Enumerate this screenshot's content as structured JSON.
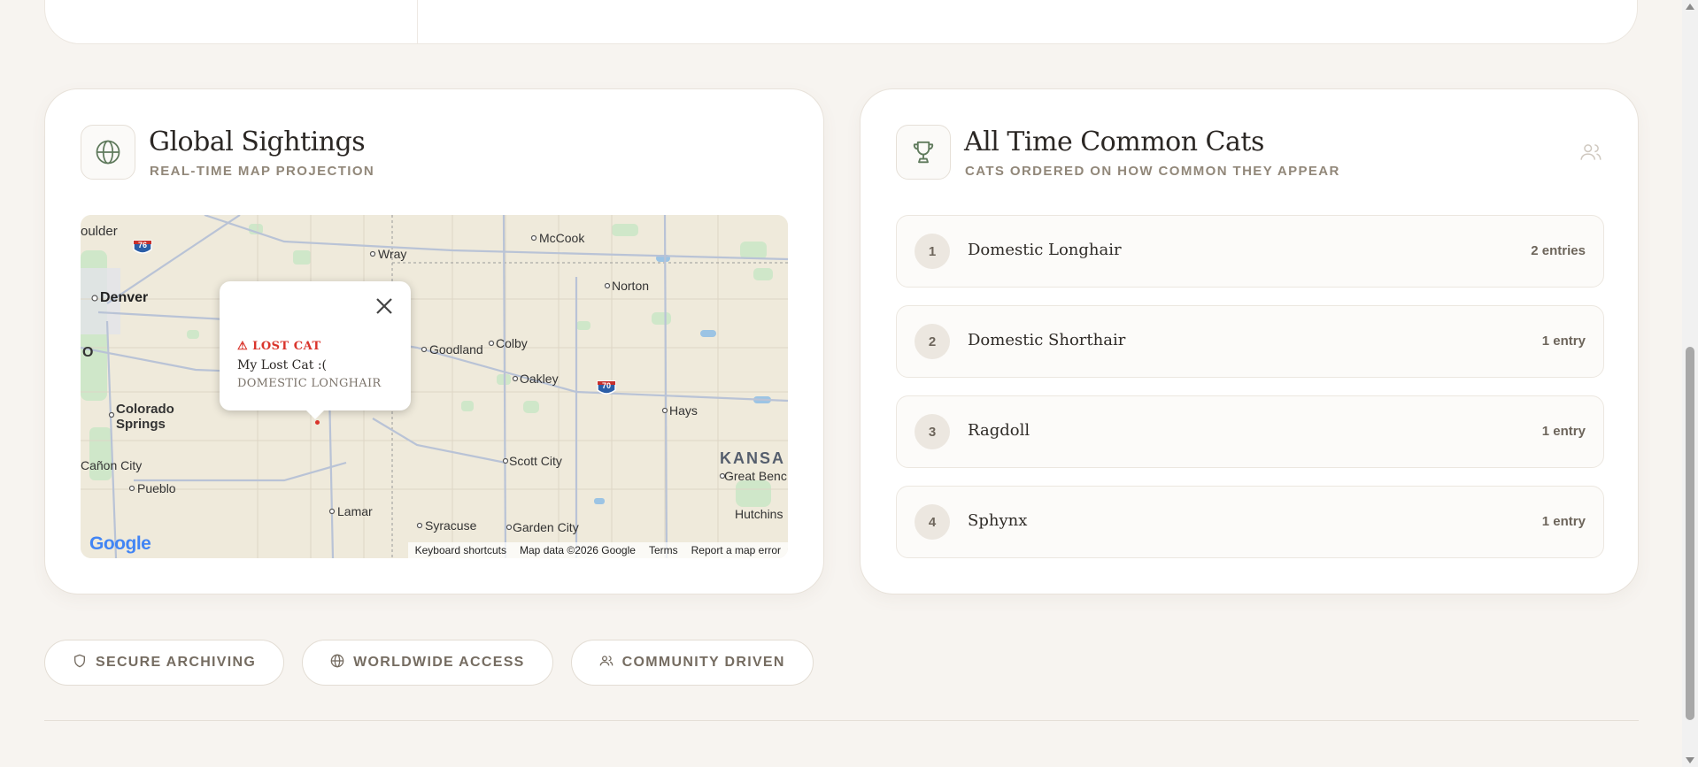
{
  "global_sightings": {
    "title": "Global Sightings",
    "subtitle": "REAL-TIME MAP PROJECTION",
    "icon": "globe-icon",
    "map": {
      "cities": [
        "oulder",
        "Denver",
        "Wray",
        "McCook",
        "Norton",
        "Goodland",
        "Colby",
        "Oakley",
        "Hays",
        "Colorado",
        "Springs",
        "Scott City",
        "KANSA",
        "Great Benc",
        "Cañon City",
        "Pueblo",
        "Lamar",
        "Syracuse",
        "Garden City",
        "Hutchins",
        "O"
      ],
      "highways": [
        "76",
        "70"
      ],
      "popup": {
        "tag": "⚠ LOST CAT",
        "name": "My Lost Cat :(",
        "breed": "DOMESTIC LONGHAIR"
      },
      "google_logo": "Google",
      "footer": {
        "shortcuts": "Keyboard shortcuts",
        "data": "Map data ©2026 Google",
        "terms": "Terms",
        "report": "Report a map error"
      },
      "colors": {
        "land": "#efeadb",
        "water": "#9cc4e4",
        "park": "#c8e6c3",
        "road": "#b9c3d6",
        "pin": "#d9342b"
      }
    }
  },
  "common_cats": {
    "title": "All Time Common Cats",
    "subtitle": "CATS ORDERED ON HOW COMMON THEY APPEAR",
    "icon": "trophy-icon",
    "items": [
      {
        "rank": "1",
        "name": "Domestic Longhair",
        "count": "2 entries"
      },
      {
        "rank": "2",
        "name": "Domestic Shorthair",
        "count": "1 entry"
      },
      {
        "rank": "3",
        "name": "Ragdoll",
        "count": "1 entry"
      },
      {
        "rank": "4",
        "name": "Sphynx",
        "count": "1 entry"
      }
    ]
  },
  "features": [
    {
      "label": "SECURE ARCHIVING",
      "icon": "shield-icon"
    },
    {
      "label": "WORLDWIDE ACCESS",
      "icon": "globe-icon"
    },
    {
      "label": "COMMUNITY DRIVEN",
      "icon": "users-icon"
    }
  ],
  "accent_color": "#5f7a5c"
}
